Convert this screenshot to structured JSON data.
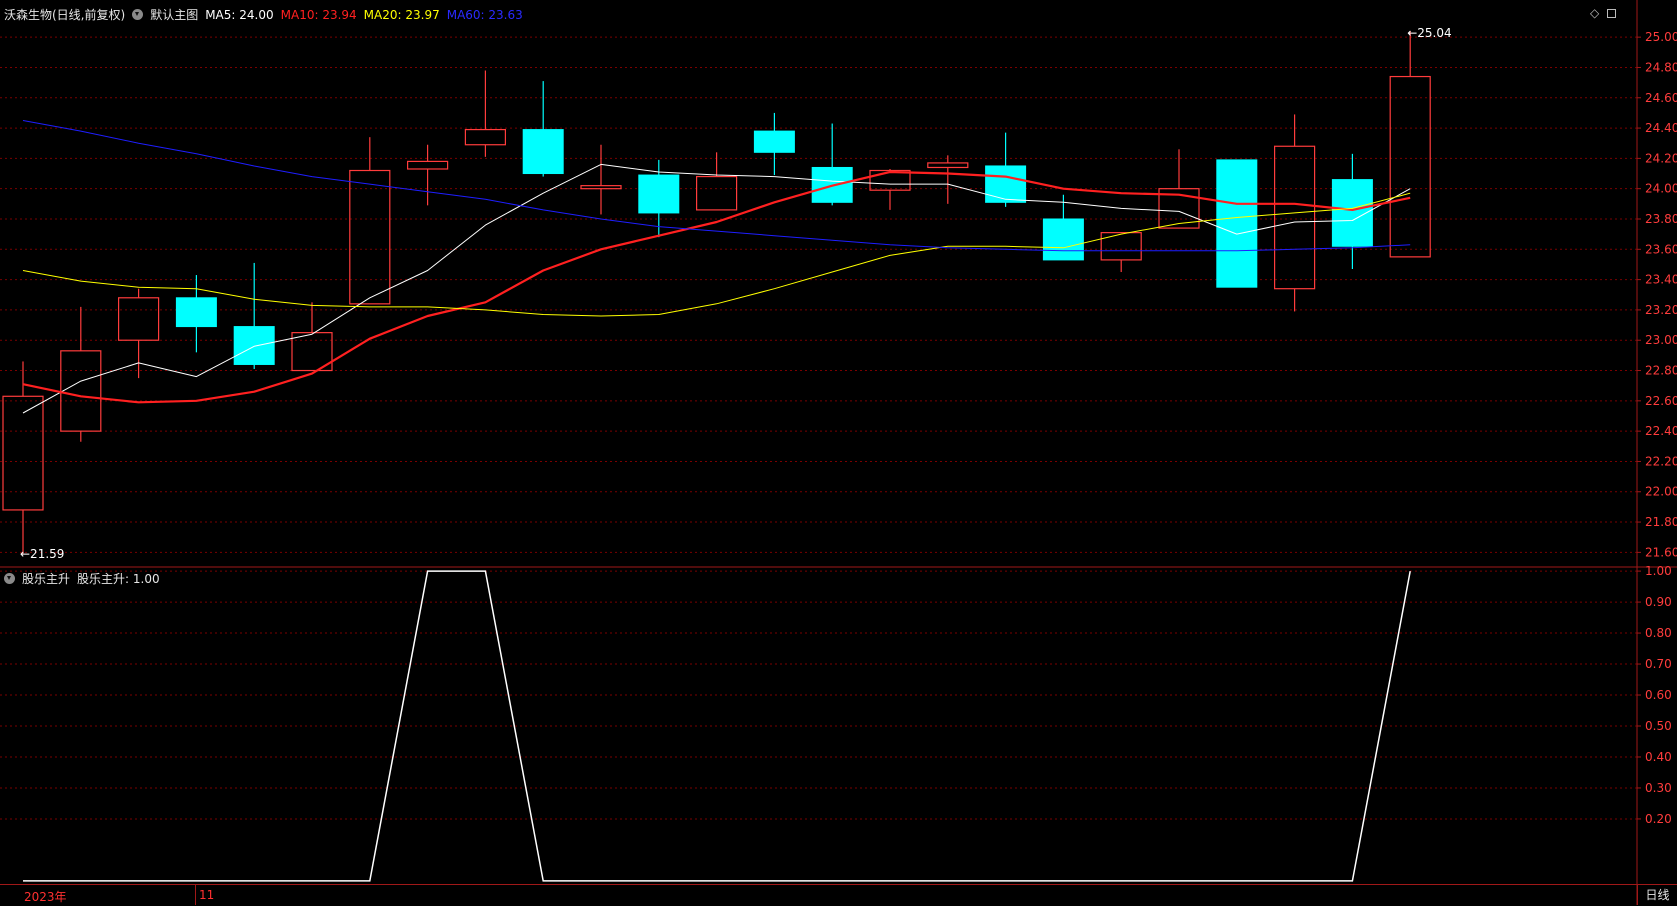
{
  "header": {
    "title": "沃森生物(日线,前复权)",
    "template_label": "默认主图",
    "ma5": {
      "label": "MA5: 24.00",
      "color": "#ffffff"
    },
    "ma10": {
      "label": "MA10: 23.94",
      "color": "#ff2020"
    },
    "ma20": {
      "label": "MA20: 23.97",
      "color": "#ffff00"
    },
    "ma60": {
      "label": "MA60: 23.63",
      "color": "#1e1eff"
    }
  },
  "sub_header": {
    "label": "股乐主升",
    "value_label": "股乐主升: 1.00"
  },
  "bottom": {
    "year_label": "2023年",
    "month_label": "11",
    "period_label": "日线"
  },
  "icons": [
    "diamond-icon",
    "restore-icon",
    "dropdown-icon"
  ],
  "colors": {
    "up": "#ff3c3c",
    "down": "#00ffff",
    "grid": "#7a0000",
    "axis": "#a01818",
    "indicator": "#ffffff"
  },
  "chart_data": [
    {
      "type": "candlestick",
      "title": "沃森生物(日线,前复权)",
      "yaxis_ticks": [
        "25.00",
        "24.80",
        "24.60",
        "24.40",
        "24.20",
        "24.00",
        "23.80",
        "23.60",
        "23.40",
        "23.20",
        "23.00",
        "22.80",
        "22.60",
        "22.40",
        "22.20",
        "22.00",
        "21.80",
        "21.60"
      ],
      "ylim": [
        21.51,
        25.1
      ],
      "candles": [
        {
          "open": 21.88,
          "high": 22.86,
          "low": 21.59,
          "close": 22.63
        },
        {
          "open": 22.4,
          "high": 23.22,
          "low": 22.33,
          "close": 22.93
        },
        {
          "open": 23.0,
          "high": 23.34,
          "low": 22.75,
          "close": 23.28
        },
        {
          "open": 23.28,
          "high": 23.43,
          "low": 22.92,
          "close": 23.09
        },
        {
          "open": 23.09,
          "high": 23.51,
          "low": 22.81,
          "close": 22.84
        },
        {
          "open": 22.8,
          "high": 23.25,
          "low": 22.8,
          "close": 23.05
        },
        {
          "open": 23.24,
          "high": 24.34,
          "low": 23.24,
          "close": 24.12
        },
        {
          "open": 24.13,
          "high": 24.29,
          "low": 23.89,
          "close": 24.18
        },
        {
          "open": 24.29,
          "high": 24.78,
          "low": 24.21,
          "close": 24.39
        },
        {
          "open": 24.39,
          "high": 24.71,
          "low": 24.08,
          "close": 24.1
        },
        {
          "open": 24.0,
          "high": 24.29,
          "low": 23.83,
          "close": 24.02
        },
        {
          "open": 24.09,
          "high": 24.19,
          "low": 23.68,
          "close": 23.84
        },
        {
          "open": 23.86,
          "high": 24.24,
          "low": 23.86,
          "close": 24.08
        },
        {
          "open": 24.38,
          "high": 24.5,
          "low": 24.09,
          "close": 24.24
        },
        {
          "open": 24.14,
          "high": 24.43,
          "low": 23.89,
          "close": 23.91
        },
        {
          "open": 23.99,
          "high": 24.13,
          "low": 23.86,
          "close": 24.12
        },
        {
          "open": 24.14,
          "high": 24.22,
          "low": 23.9,
          "close": 24.17
        },
        {
          "open": 24.15,
          "high": 24.37,
          "low": 23.88,
          "close": 23.91
        },
        {
          "open": 23.8,
          "high": 23.96,
          "low": 23.53,
          "close": 23.53
        },
        {
          "open": 23.53,
          "high": 23.71,
          "low": 23.45,
          "close": 23.71
        },
        {
          "open": 23.74,
          "high": 24.26,
          "low": 23.74,
          "close": 24.0
        },
        {
          "open": 24.19,
          "high": 24.19,
          "low": 23.35,
          "close": 23.35
        },
        {
          "open": 23.34,
          "high": 24.49,
          "low": 23.19,
          "close": 24.28
        },
        {
          "open": 24.06,
          "high": 24.23,
          "low": 23.47,
          "close": 23.62
        },
        {
          "open": 23.55,
          "high": 25.04,
          "low": 23.55,
          "close": 24.74
        }
      ],
      "annotations": [
        {
          "label": "25.04",
          "candle": 24,
          "at": "high"
        },
        {
          "label": "21.59",
          "candle": 0,
          "at": "low"
        }
      ],
      "series": [
        {
          "name": "MA5",
          "color": "#ffffff",
          "width": 1,
          "values": [
            22.52,
            22.73,
            22.85,
            22.76,
            22.96,
            23.04,
            23.28,
            23.46,
            23.76,
            23.97,
            24.16,
            24.11,
            24.09,
            24.08,
            24.05,
            24.03,
            24.03,
            23.93,
            23.91,
            23.87,
            23.85,
            23.7,
            23.78,
            23.79,
            24.0
          ]
        },
        {
          "name": "MA10",
          "color": "#ff2020",
          "width": 2.2,
          "values": [
            22.71,
            22.63,
            22.59,
            22.6,
            22.66,
            22.78,
            23.01,
            23.16,
            23.25,
            23.46,
            23.6,
            23.69,
            23.78,
            23.91,
            24.02,
            24.11,
            24.1,
            24.08,
            24.0,
            23.97,
            23.96,
            23.9,
            23.9,
            23.86,
            23.94
          ]
        },
        {
          "name": "MA20",
          "color": "#ffff00",
          "width": 1,
          "values": [
            23.46,
            23.39,
            23.35,
            23.34,
            23.27,
            23.23,
            23.22,
            23.22,
            23.2,
            23.17,
            23.16,
            23.17,
            23.24,
            23.34,
            23.45,
            23.56,
            23.62,
            23.62,
            23.61,
            23.7,
            23.77,
            23.81,
            23.84,
            23.87,
            23.97
          ]
        },
        {
          "name": "MA60",
          "color": "#1e1eff",
          "width": 1,
          "values": [
            24.45,
            24.38,
            24.3,
            24.23,
            24.15,
            24.08,
            24.03,
            23.98,
            23.93,
            23.86,
            23.8,
            23.75,
            23.72,
            23.69,
            23.66,
            23.63,
            23.61,
            23.6,
            23.59,
            23.59,
            23.59,
            23.59,
            23.6,
            23.61,
            23.63
          ]
        }
      ]
    },
    {
      "type": "line",
      "title": "股乐主升",
      "yaxis_ticks": [
        "1.00",
        "0.90",
        "0.80",
        "0.70",
        "0.60",
        "0.50",
        "0.40",
        "0.30",
        "0.20"
      ],
      "ylim": [
        -0.01,
        1.01
      ],
      "series": [
        {
          "name": "股乐主升",
          "color": "#ffffff",
          "values": [
            0,
            0,
            0,
            0,
            0,
            0,
            0,
            1,
            1,
            0,
            0,
            0,
            0,
            0,
            0,
            0,
            0,
            0,
            0,
            0,
            0,
            0,
            0,
            0,
            1
          ]
        }
      ]
    }
  ]
}
